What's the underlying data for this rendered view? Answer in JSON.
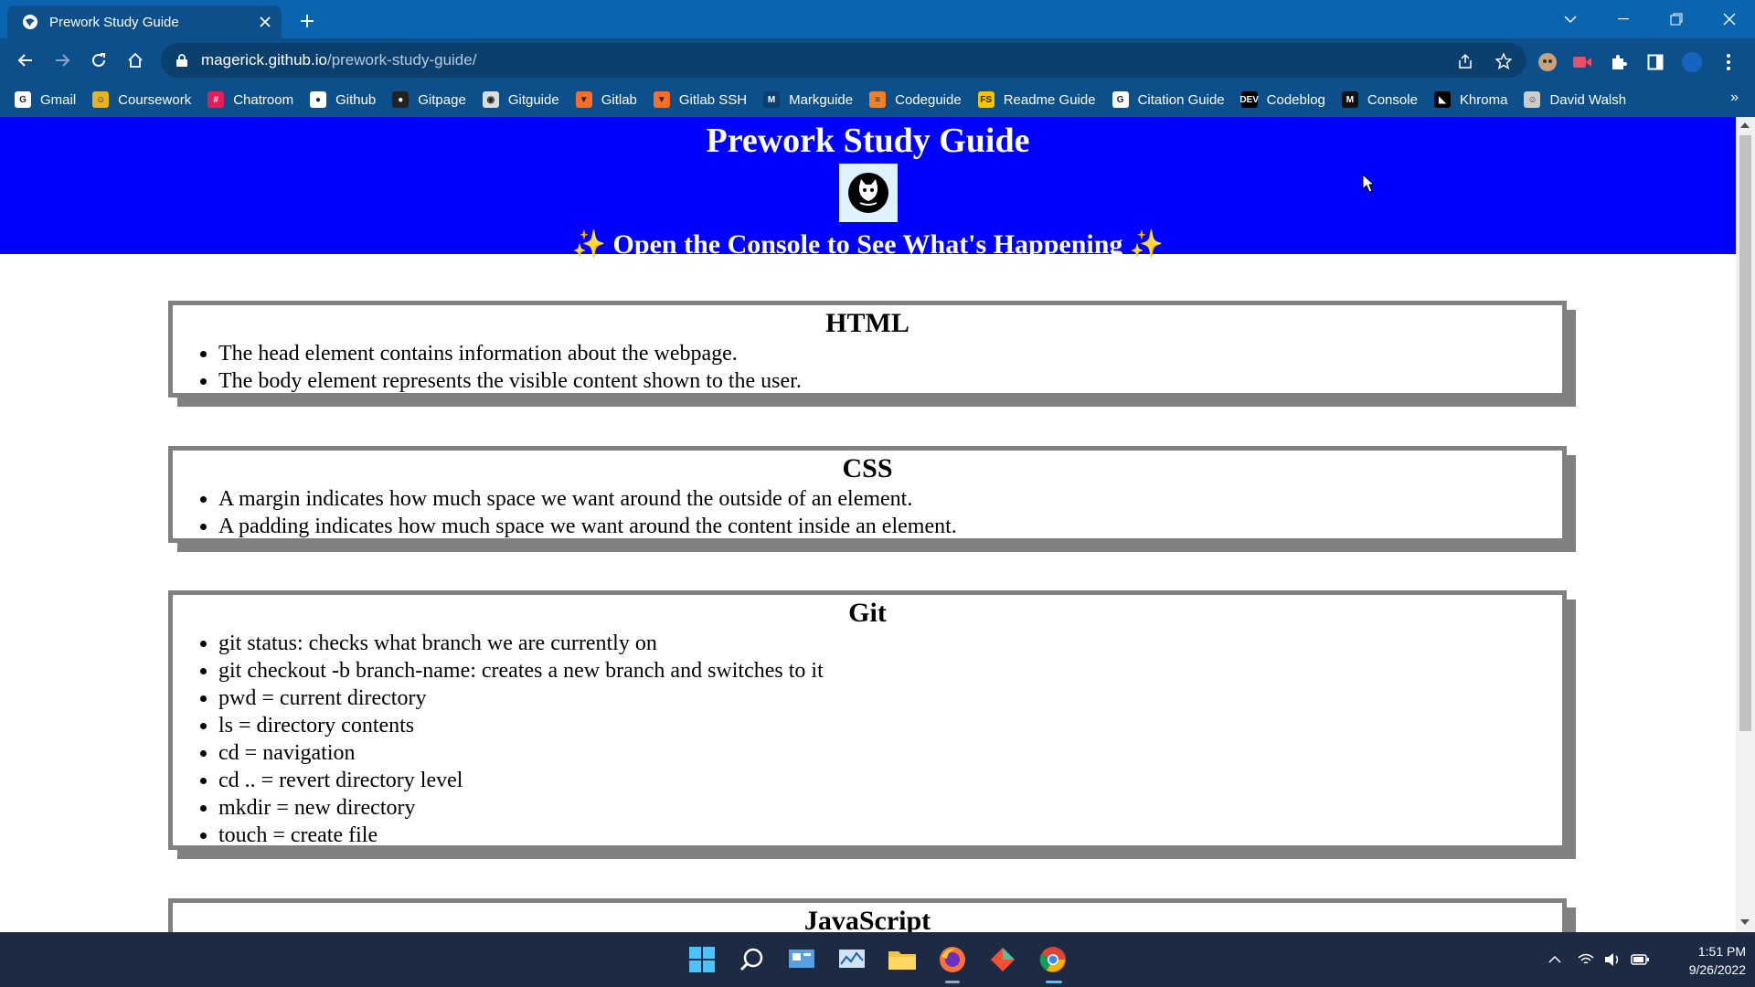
{
  "browser": {
    "tab_title": "Prework Study Guide",
    "url_host": "magerick.github.io",
    "url_path": "/prework-study-guide/",
    "bookmarks": [
      {
        "label": "Gmail",
        "icon": "google-icon",
        "color": "#ffffff"
      },
      {
        "label": "Coursework",
        "icon": "coursework-icon",
        "color": "#e6b422"
      },
      {
        "label": "Chatroom",
        "icon": "slack-icon",
        "color": "#e01e5a"
      },
      {
        "label": "Github",
        "icon": "github-icon",
        "color": "#ffffff"
      },
      {
        "label": "Gitpage",
        "icon": "github-icon",
        "color": "#222222"
      },
      {
        "label": "Gitguide",
        "icon": "globe-icon",
        "color": "#dddddd"
      },
      {
        "label": "Gitlab",
        "icon": "gitlab-icon",
        "color": "#fc6d26"
      },
      {
        "label": "Gitlab SSH",
        "icon": "gitlab-icon",
        "color": "#fc6d26"
      },
      {
        "label": "Markguide",
        "icon": "markdown-icon",
        "color": "#0a3f6e"
      },
      {
        "label": "Codeguide",
        "icon": "stackoverflow-icon",
        "color": "#f48024"
      },
      {
        "label": "Readme Guide",
        "icon": "fs-icon",
        "color": "#f5c400"
      },
      {
        "label": "Citation Guide",
        "icon": "google-icon",
        "color": "#ffffff"
      },
      {
        "label": "Codeblog",
        "icon": "dev-icon",
        "color": "#000000"
      },
      {
        "label": "Console",
        "icon": "m-icon",
        "color": "#111111"
      },
      {
        "label": "Khroma",
        "icon": "khroma-icon",
        "color": "#000000"
      },
      {
        "label": "David Walsh",
        "icon": "walsh-icon",
        "color": "#cccccc"
      }
    ],
    "more_label": "»"
  },
  "page": {
    "title": "Prework Study Guide",
    "subtitle": "✨ Open the Console to See What's Happening ✨",
    "sections": [
      {
        "heading": "HTML",
        "items": [
          "The head element contains information about the webpage.",
          "The body element represents the visible content shown to the user."
        ]
      },
      {
        "heading": "CSS",
        "items": [
          "A margin indicates how much space we want around the outside of an element.",
          "A padding indicates how much space we want around the content inside an element."
        ]
      },
      {
        "heading": "Git",
        "items": [
          "git status: checks what branch we are currently on",
          "git checkout -b branch-name: creates a new branch and switches to it",
          "pwd = current directory",
          "ls = directory contents",
          "cd = navigation",
          "cd .. = revert directory level",
          "mkdir = new directory",
          "touch = create file"
        ]
      },
      {
        "heading": "JavaScript",
        "items": []
      }
    ]
  },
  "taskbar": {
    "time": "1:51 PM",
    "date": "9/26/2022"
  },
  "colors": {
    "header_bg": "#0000ff",
    "chrome_dark": "#0d4f8a",
    "chrome_light": "#0a64b0",
    "card_border": "#808080"
  }
}
